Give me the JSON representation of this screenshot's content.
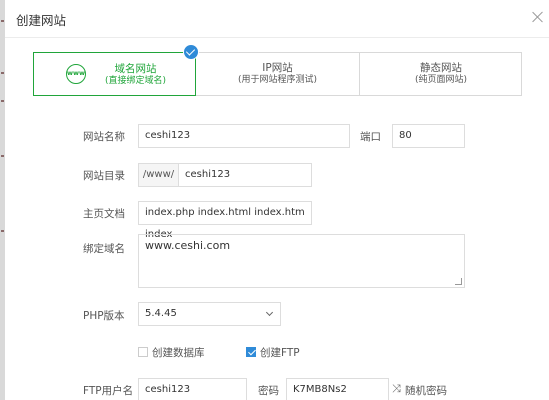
{
  "dialog": {
    "title": "创建网站"
  },
  "tabs": [
    {
      "label": "域名网站",
      "sub": "(直接绑定域名)"
    },
    {
      "label": "IP网站",
      "sub": "(用于网站程序测试)"
    },
    {
      "label": "静态网站",
      "sub": "(纯页面网站)"
    }
  ],
  "form": {
    "site_name": {
      "label": "网站名称",
      "value": "ceshi123"
    },
    "port": {
      "label": "端口",
      "value": "80"
    },
    "site_dir": {
      "label": "网站目录",
      "prefix": "/www/",
      "value": "ceshi123"
    },
    "index_doc": {
      "label": "主页文档",
      "value": "index.php index.html index.htm index"
    },
    "domain": {
      "label": "绑定域名",
      "value": "www.ceshi.com"
    },
    "php": {
      "label": "PHP版本",
      "value": "5.4.45"
    },
    "options": [
      {
        "label": "创建数据库",
        "checked": false
      },
      {
        "label": "创建FTP",
        "checked": true
      }
    ],
    "ftp_user": {
      "label": "FTP用户名",
      "value": "ceshi123"
    },
    "ftp_pass": {
      "label": "密码",
      "value": "K7MB8Ns2"
    },
    "random_pass": {
      "label": "随机密码",
      "icon": "shuffle-icon"
    }
  },
  "colors": {
    "accent": "#20a53a",
    "check_blue": "#2f8bd8"
  }
}
